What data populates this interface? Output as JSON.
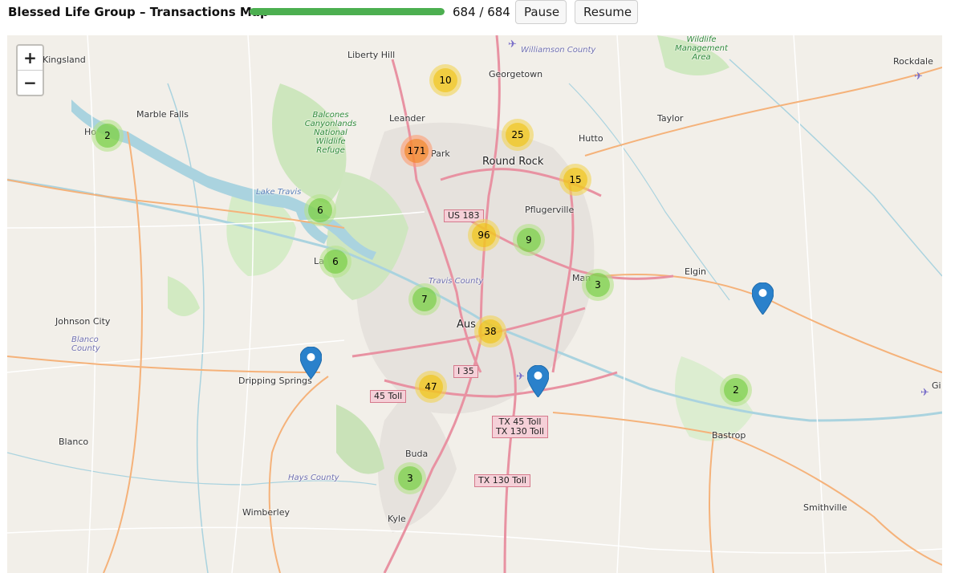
{
  "header": {
    "title": "Blessed Life Group – Transactions Map",
    "progress_fraction": 1.0,
    "progress_text": "684 / 684",
    "pause_label": "Pause",
    "resume_label": "Resume"
  },
  "colors": {
    "progress": "#4caf50",
    "marker": "#2a81cb",
    "cluster_small": "#6ecc39",
    "cluster_medium": "#f0c20c",
    "cluster_large": "#f18017"
  },
  "map": {
    "zoom_in": "+",
    "zoom_out": "−",
    "clusters": [
      {
        "count": "2",
        "size": "small"
      },
      {
        "count": "10",
        "size": "medium"
      },
      {
        "count": "171",
        "size": "large"
      },
      {
        "count": "25",
        "size": "medium"
      },
      {
        "count": "15",
        "size": "medium"
      },
      {
        "count": "6",
        "size": "small"
      },
      {
        "count": "96",
        "size": "medium"
      },
      {
        "count": "9",
        "size": "small"
      },
      {
        "count": "6",
        "size": "small"
      },
      {
        "count": "3",
        "size": "small"
      },
      {
        "count": "7",
        "size": "small"
      },
      {
        "count": "38",
        "size": "medium"
      },
      {
        "count": "47",
        "size": "medium"
      },
      {
        "count": "2",
        "size": "small"
      },
      {
        "count": "3",
        "size": "small"
      }
    ],
    "places": {
      "kingsland": "Kingsland",
      "liberty_hill": "Liberty Hill",
      "georgetown": "Georgetown",
      "williamson_county": "Williamson County",
      "rockdale": "Rockdale",
      "marble_falls": "Marble Falls",
      "horseshoe_bay": "Ho",
      "leander": "Leander",
      "cedar_park": "Park",
      "round_rock": "Round Rock",
      "hutto": "Hutto",
      "taylor": "Taylor",
      "lake_travis": "Lake Travis",
      "pflugerville": "Pflugerville",
      "lakeway": "La",
      "travis_county": "Travis County",
      "manor": "Man",
      "elgin": "Elgin",
      "johnson_city": "Johnson City",
      "blanco_county": "Blanco County",
      "austin": "Aus",
      "dripping_springs": "Dripping Springs",
      "blanco": "Blanco",
      "bastrop": "Bastrop",
      "buda": "Buda",
      "hays_county": "Hays County",
      "wimberley": "Wimberley",
      "kyle": "Kyle",
      "smithville": "Smithville",
      "giddings": "Gi",
      "balcones": "Balcones Canyonlands National Wildlife Refuge",
      "management_area": "Wildlife Management Area"
    },
    "highways": {
      "us183": "US 183",
      "i35": "I 35",
      "toll45": "45 Toll",
      "tx45_130_line1": "TX 45 Toll",
      "tx45_130_line2": "TX 130 Toll",
      "tx130": "TX 130 Toll"
    }
  }
}
